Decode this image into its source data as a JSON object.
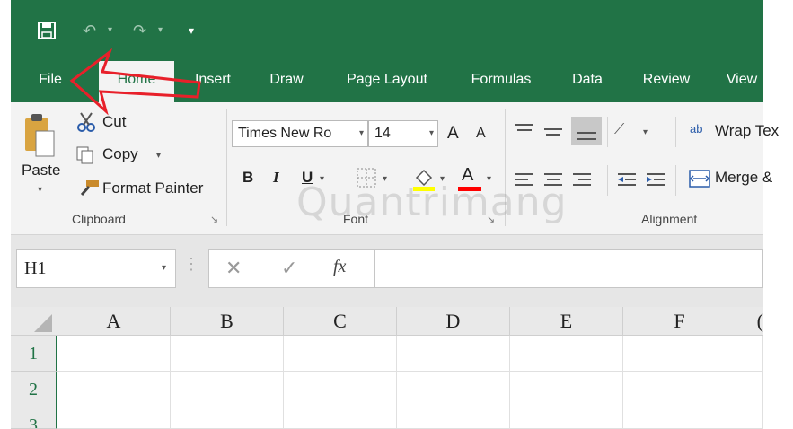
{
  "qat": {
    "save_icon": "save-icon",
    "undo_icon": "undo-icon",
    "redo_icon": "redo-icon",
    "customize_icon": "customize-qat-icon"
  },
  "tabs": [
    {
      "label": "File"
    },
    {
      "label": "Home"
    },
    {
      "label": "Insert"
    },
    {
      "label": "Draw"
    },
    {
      "label": "Page Layout"
    },
    {
      "label": "Formulas"
    },
    {
      "label": "Data"
    },
    {
      "label": "Review"
    },
    {
      "label": "View"
    }
  ],
  "clipboard": {
    "paste": "Paste",
    "cut": "Cut",
    "copy": "Copy",
    "format_painter": "Format Painter",
    "group_label": "Clipboard"
  },
  "font": {
    "font_name": "Times New Ro",
    "font_size": "14",
    "bold": "B",
    "italic": "I",
    "underline": "U",
    "font_color": "A",
    "grow": "A",
    "shrink": "A",
    "group_label": "Font",
    "highlight_color": "#ffff00",
    "text_color": "#ff0000"
  },
  "alignment": {
    "wrap_text": "Wrap Tex",
    "wrap_glyph": "ab",
    "merge": "Merge &",
    "group_label": "Alignment"
  },
  "formula_bar": {
    "name_box": "H1",
    "fx": "fx"
  },
  "grid": {
    "columns": [
      "A",
      "B",
      "C",
      "D",
      "E",
      "F",
      "("
    ],
    "rows": [
      "1",
      "2",
      "3"
    ]
  },
  "watermark": "Quantrimang",
  "colors": {
    "accent": "#217346",
    "arrow": "#e8202a"
  }
}
